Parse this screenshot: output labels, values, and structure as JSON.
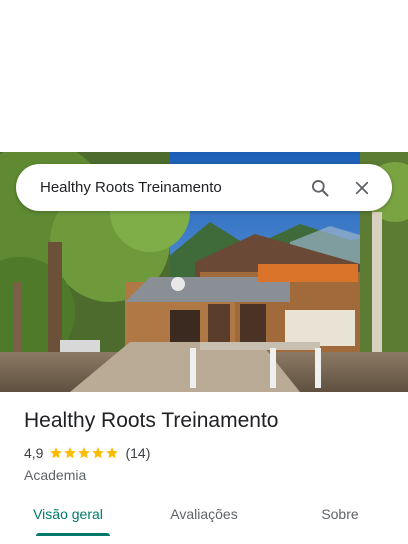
{
  "search": {
    "query": "Healthy Roots Treinamento"
  },
  "place": {
    "name": "Healthy Roots Treinamento",
    "rating": "4,9",
    "stars": 5,
    "review_count": "(14)",
    "category": "Academia"
  },
  "tabs": [
    {
      "label": "Visão geral",
      "active": true
    },
    {
      "label": "Avaliações",
      "active": false
    },
    {
      "label": "Sobre",
      "active": false
    }
  ],
  "colors": {
    "accent": "#00796b",
    "star": "#fbbc04",
    "sky": "#3a86d6"
  },
  "icons": [
    "search-icon",
    "close-icon",
    "star-icon"
  ]
}
